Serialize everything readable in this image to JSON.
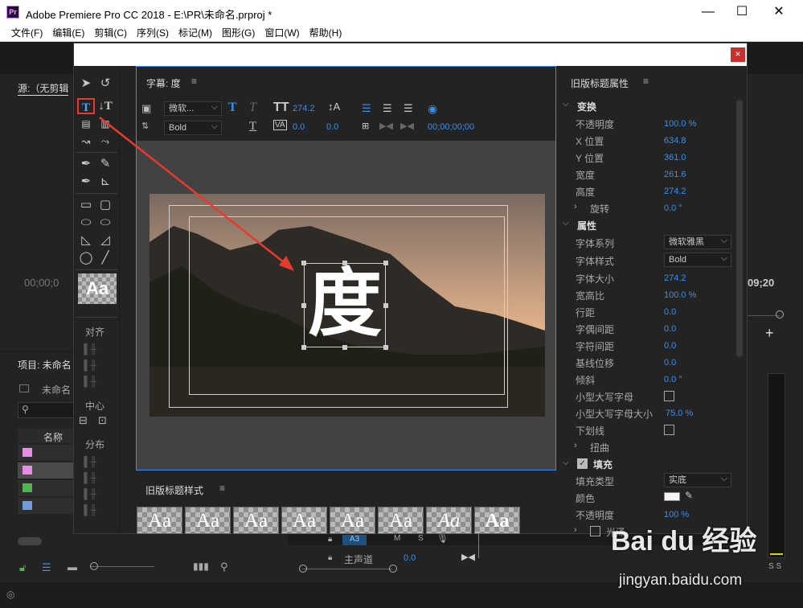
{
  "window": {
    "title": "Adobe Premiere Pro CC 2018 - E:\\PR\\未命名.prproj *",
    "minimize": "—",
    "maximize": "☐",
    "close": "✕",
    "app_icon": "Pr"
  },
  "menu": [
    "文件(F)",
    "编辑(E)",
    "剪辑(C)",
    "序列(S)",
    "标记(M)",
    "图形(G)",
    "窗口(W)",
    "帮助(H)"
  ],
  "background": {
    "source_tab": "源:（无剪辑",
    "timecode_left": "00;00;0",
    "timecode_right": "09;20",
    "project_tab": "项目: 未命名",
    "project_file": "未命名",
    "col_name": "名称",
    "main_track": "主声道",
    "track_a3": "A3",
    "track_m": "M",
    "track_s": "S",
    "main_vol": "0.0",
    "ss": "S S"
  },
  "dialog": {
    "close": "×"
  },
  "titler": {
    "tab": "字幕: 度",
    "font": "微软...",
    "style": "Bold",
    "size": "274.2",
    "kerning": "0.0",
    "leading": "0.0",
    "tracking": "0.0",
    "timecode": "00;00;00;00",
    "char": "度"
  },
  "tools": {
    "align_label": "对齐",
    "center_label": "中心",
    "distribute_label": "分布",
    "aa": "Aa"
  },
  "styles": {
    "tab": "旧版标题样式",
    "items": [
      "Aa",
      "Aa",
      "Aa",
      "Aa",
      "Aa",
      "Aa",
      "Aa",
      "Aa"
    ]
  },
  "props": {
    "tab": "旧版标题属性",
    "transform": "变换",
    "opacity_label": "不透明度",
    "opacity": "100.0 %",
    "x_label": "X 位置",
    "x": "634.8",
    "y_label": "Y 位置",
    "y": "361.0",
    "w_label": "宽度",
    "w": "261.6",
    "h_label": "高度",
    "h": "274.2",
    "rot_label": "旋转",
    "rot": "0.0 °",
    "attributes": "属性",
    "family_label": "字体系列",
    "family": "微软雅黑",
    "style_label": "字体样式",
    "style": "Bold",
    "size_label": "字体大小",
    "size": "274.2",
    "aspect_label": "宽高比",
    "aspect": "100.0 %",
    "leading_label": "行距",
    "leading": "0.0",
    "kern_label": "字偶间距",
    "kern": "0.0",
    "track_label": "字符间距",
    "track": "0.0",
    "baseline_label": "基线位移",
    "baseline": "0.0",
    "slant_label": "倾斜",
    "slant": "0.0 °",
    "smallcaps_label": "小型大写字母",
    "smallcaps_size_label": "小型大写字母大小",
    "smallcaps_size": "75.0 %",
    "underline_label": "下划线",
    "distort_label": "扭曲",
    "fill": "填充",
    "filltype_label": "填充类型",
    "filltype": "实底",
    "color_label": "颜色",
    "fill_opacity_label": "不透明度",
    "fill_opacity": "100 %",
    "sheen_label": "光泽"
  },
  "watermark": {
    "brand": "Bai du 经验",
    "url": "jingyan.baidu.com"
  }
}
